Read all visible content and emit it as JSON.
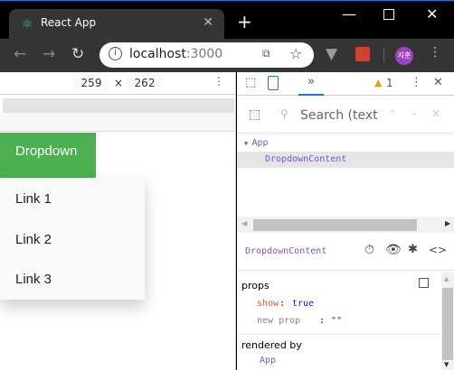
{
  "browser": {
    "tab_title": "React App",
    "url_host": "localhost",
    "url_port": ":3000",
    "avatar_text": "지훈"
  },
  "device_toolbar": {
    "width": "259",
    "times": "×",
    "height": "262"
  },
  "page": {
    "dropdown_label": "Dropdown",
    "links": [
      "Link 1",
      "Link 2",
      "Link 3"
    ],
    "accent": "#4caf50"
  },
  "devtools": {
    "more_tabs": "»",
    "warnings": "1",
    "search_placeholder": "Search (text",
    "tree": [
      {
        "name": "App"
      },
      {
        "name": "DropdownContent"
      }
    ],
    "selected": "DropdownContent",
    "props_title": "props",
    "props": [
      {
        "key": "show",
        "value": "true"
      },
      {
        "key": "new prop",
        "value": "\"\""
      }
    ],
    "rendered_by_title": "rendered by",
    "rendered_by": "App"
  }
}
